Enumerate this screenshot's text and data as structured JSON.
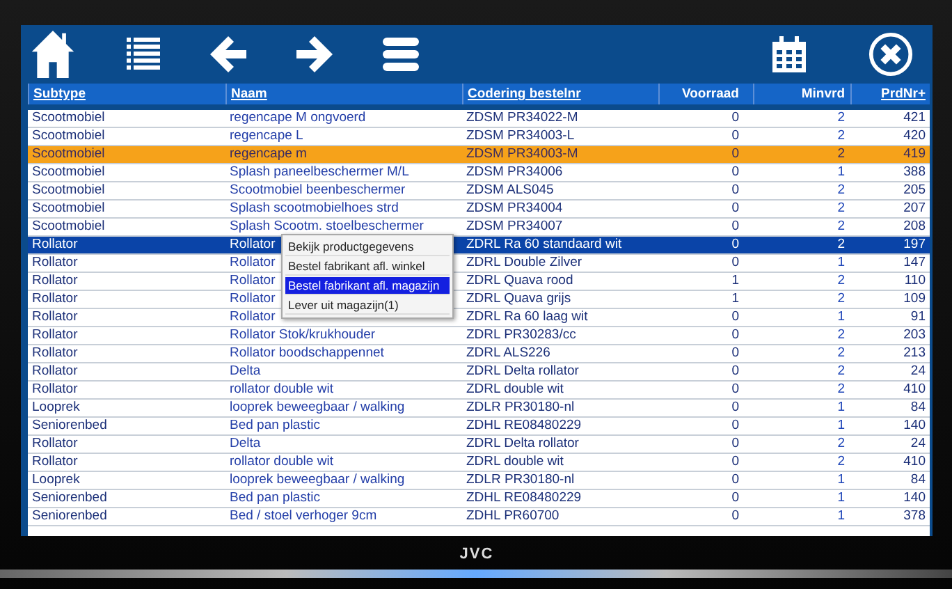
{
  "columns": [
    {
      "label": "Subtype",
      "sortable": true
    },
    {
      "label": "Naam",
      "sortable": true
    },
    {
      "label": "Codering bestelnr",
      "sortable": true
    },
    {
      "label": "Voorraad",
      "sortable": false
    },
    {
      "label": "Minvrd",
      "sortable": false
    },
    {
      "label": "PrdNr+",
      "sortable": true
    }
  ],
  "rows": [
    {
      "cells": [
        "Scootmobiel",
        "regencape M ongvoerd",
        "ZDSM PR34022-M",
        "0",
        "2",
        "421"
      ],
      "selected": false,
      "flagged": false
    },
    {
      "cells": [
        "Scootmobiel",
        "regencape L",
        "ZDSM PR34003-L",
        "0",
        "2",
        "420"
      ],
      "selected": false,
      "flagged": false
    },
    {
      "cells": [
        "Scootmobiel",
        "regencape m",
        "ZDSM PR34003-M",
        "0",
        "2",
        "419"
      ],
      "selected": false,
      "flagged": true
    },
    {
      "cells": [
        "Scootmobiel",
        "Splash paneelbeschermer M/L",
        "ZDSM PR34006",
        "0",
        "1",
        "388"
      ],
      "selected": false,
      "flagged": false
    },
    {
      "cells": [
        "Scootmobiel",
        "Scootmobiel beenbeschermer",
        "ZDSM ALS045",
        "0",
        "2",
        "205"
      ],
      "selected": false,
      "flagged": false
    },
    {
      "cells": [
        "Scootmobiel",
        "Splash scootmobielhoes strd",
        "ZDSM PR34004",
        "0",
        "2",
        "207"
      ],
      "selected": false,
      "flagged": false
    },
    {
      "cells": [
        "Scootmobiel",
        "Splash Scootm. stoelbeschermer",
        "ZDSM PR34007",
        "0",
        "2",
        "208"
      ],
      "selected": false,
      "flagged": false
    },
    {
      "cells": [
        "Rollator",
        "Rollator",
        "ZDRL Ra 60 standaard wit",
        "0",
        "2",
        "197"
      ],
      "selected": true,
      "flagged": false
    },
    {
      "cells": [
        "Rollator",
        "Rollator",
        "ZDRL Double Zilver",
        "0",
        "1",
        "147"
      ],
      "selected": false,
      "flagged": false
    },
    {
      "cells": [
        "Rollator",
        "Rollator",
        "ZDRL Quava rood",
        "1",
        "2",
        "110"
      ],
      "selected": false,
      "flagged": false
    },
    {
      "cells": [
        "Rollator",
        "Rollator",
        "ZDRL Quava grijs",
        "1",
        "2",
        "109"
      ],
      "selected": false,
      "flagged": false
    },
    {
      "cells": [
        "Rollator",
        "Rollator",
        "ZDRL Ra 60 laag wit",
        "0",
        "1",
        "91"
      ],
      "selected": false,
      "flagged": false
    },
    {
      "cells": [
        "Rollator",
        "Rollator Stok/krukhouder",
        "ZDRL PR30283/cc",
        "0",
        "2",
        "203"
      ],
      "selected": false,
      "flagged": false
    },
    {
      "cells": [
        "Rollator",
        "Rollator boodschappennet",
        "ZDRL ALS226",
        "0",
        "2",
        "213"
      ],
      "selected": false,
      "flagged": false
    },
    {
      "cells": [
        "Rollator",
        "Delta",
        "ZDRL Delta rollator",
        "0",
        "2",
        "24"
      ],
      "selected": false,
      "flagged": false
    },
    {
      "cells": [
        "Rollator",
        "rollator double wit",
        "ZDRL double wit",
        "0",
        "2",
        "410"
      ],
      "selected": false,
      "flagged": false
    },
    {
      "cells": [
        "Looprek",
        "looprek beweegbaar / walking",
        "ZDLR PR30180-nl",
        "0",
        "1",
        "84"
      ],
      "selected": false,
      "flagged": false
    },
    {
      "cells": [
        "Seniorenbed",
        "Bed pan plastic",
        "ZDHL RE08480229",
        "0",
        "1",
        "140"
      ],
      "selected": false,
      "flagged": false
    },
    {
      "cells": [
        "Rollator",
        "Delta",
        "ZDRL Delta rollator",
        "0",
        "2",
        "24"
      ],
      "selected": false,
      "flagged": false
    },
    {
      "cells": [
        "Rollator",
        "rollator double wit",
        "ZDRL double wit",
        "0",
        "2",
        "410"
      ],
      "selected": false,
      "flagged": false
    },
    {
      "cells": [
        "Looprek",
        "looprek beweegbaar / walking",
        "ZDLR PR30180-nl",
        "0",
        "1",
        "84"
      ],
      "selected": false,
      "flagged": false
    },
    {
      "cells": [
        "Seniorenbed",
        "Bed pan plastic",
        "ZDHL RE08480229",
        "0",
        "1",
        "140"
      ],
      "selected": false,
      "flagged": false
    },
    {
      "cells": [
        "Seniorenbed",
        "Bed / stoel verhoger 9cm",
        "ZDHL PR60700",
        "0",
        "1",
        "378"
      ],
      "selected": false,
      "flagged": false
    }
  ],
  "context_menu": [
    {
      "label": "Bekijk productgegevens",
      "selected": false
    },
    {
      "label": "Bestel fabrikant afl. winkel",
      "selected": false
    },
    {
      "label": "Bestel fabrikant afl. magazijn",
      "selected": true
    },
    {
      "label": "Lever uit magazijn(1)",
      "selected": false
    }
  ],
  "brand": "JVC"
}
